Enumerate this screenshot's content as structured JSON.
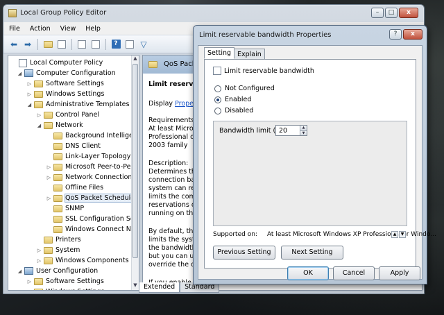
{
  "window": {
    "title": "Local Group Policy Editor",
    "menu": [
      "File",
      "Action",
      "View",
      "Help"
    ],
    "min_glyph": "–",
    "max_glyph": "□",
    "close_glyph": "x"
  },
  "tree": {
    "items": [
      {
        "label": "Local Computer Policy",
        "expander": "",
        "icon": "doc"
      },
      {
        "label": "Computer Configuration",
        "expander": "◢",
        "icon": "pc"
      },
      {
        "label": "Software Settings",
        "expander": "▷",
        "icon": "folder"
      },
      {
        "label": "Windows Settings",
        "expander": "▷",
        "icon": "folder"
      },
      {
        "label": "Administrative Templates",
        "expander": "◢",
        "icon": "folder"
      },
      {
        "label": "Control Panel",
        "expander": "▷",
        "icon": "folder"
      },
      {
        "label": "Network",
        "expander": "◢",
        "icon": "folder"
      },
      {
        "label": "Background Intellige",
        "expander": "",
        "icon": "folder"
      },
      {
        "label": "DNS Client",
        "expander": "",
        "icon": "folder"
      },
      {
        "label": "Link-Layer Topology",
        "expander": "",
        "icon": "folder"
      },
      {
        "label": "Microsoft Peer-to-Pe",
        "expander": "▷",
        "icon": "folder"
      },
      {
        "label": "Network Connection",
        "expander": "▷",
        "icon": "folder"
      },
      {
        "label": "Offline Files",
        "expander": "",
        "icon": "folder"
      },
      {
        "label": "QoS Packet Schedule",
        "expander": "▷",
        "icon": "folder"
      },
      {
        "label": "SNMP",
        "expander": "",
        "icon": "folder"
      },
      {
        "label": "SSL Configuration Se",
        "expander": "",
        "icon": "folder"
      },
      {
        "label": "Windows Connect N",
        "expander": "",
        "icon": "folder"
      },
      {
        "label": "Printers",
        "expander": "",
        "icon": "folder"
      },
      {
        "label": "System",
        "expander": "▷",
        "icon": "folder"
      },
      {
        "label": "Windows Components",
        "expander": "▷",
        "icon": "folder"
      },
      {
        "label": "User Configuration",
        "expander": "◢",
        "icon": "pc"
      },
      {
        "label": "Software Settings",
        "expander": "▷",
        "icon": "folder"
      },
      {
        "label": "Windows Settings",
        "expander": "▷",
        "icon": "folder"
      }
    ]
  },
  "right_pane": {
    "header": "QoS Packe",
    "policy_title": "Limit reservabl",
    "display_prefix": "Display",
    "display_link": "Properti",
    "requirements_heading": "Requirements:",
    "requirements_lines": [
      "At least Microso",
      "Professional or W",
      "2003 family"
    ],
    "description_heading": "Description:",
    "description_lines": [
      "Determines the",
      "connection ban",
      "system can rese",
      "limits the comb",
      "reservations of a",
      "running on the"
    ],
    "default_lines": [
      "By default, the P",
      "limits the syster",
      "the bandwidth o",
      "but you can use",
      "override the defa"
    ],
    "enable_line": "If you enable th",
    "tabs": [
      "Extended",
      "Standard"
    ]
  },
  "dialog": {
    "title": "Limit reservable bandwidth Properties",
    "help_glyph": "?",
    "close_glyph": "x",
    "tabs": [
      "Setting",
      "Explain"
    ],
    "setting_name": "Limit reservable bandwidth",
    "options": [
      "Not Configured",
      "Enabled",
      "Disabled"
    ],
    "selected_option": "Enabled",
    "bandwidth_label": "Bandwidth limit (%):",
    "bandwidth_value": "20",
    "supported_label": "Supported on:",
    "supported_value": "At least Microsoft Windows XP Professional or Windo...",
    "prev_button": "Previous Setting",
    "next_button": "Next Setting",
    "ok": "OK",
    "cancel": "Cancel",
    "apply": "Apply"
  }
}
